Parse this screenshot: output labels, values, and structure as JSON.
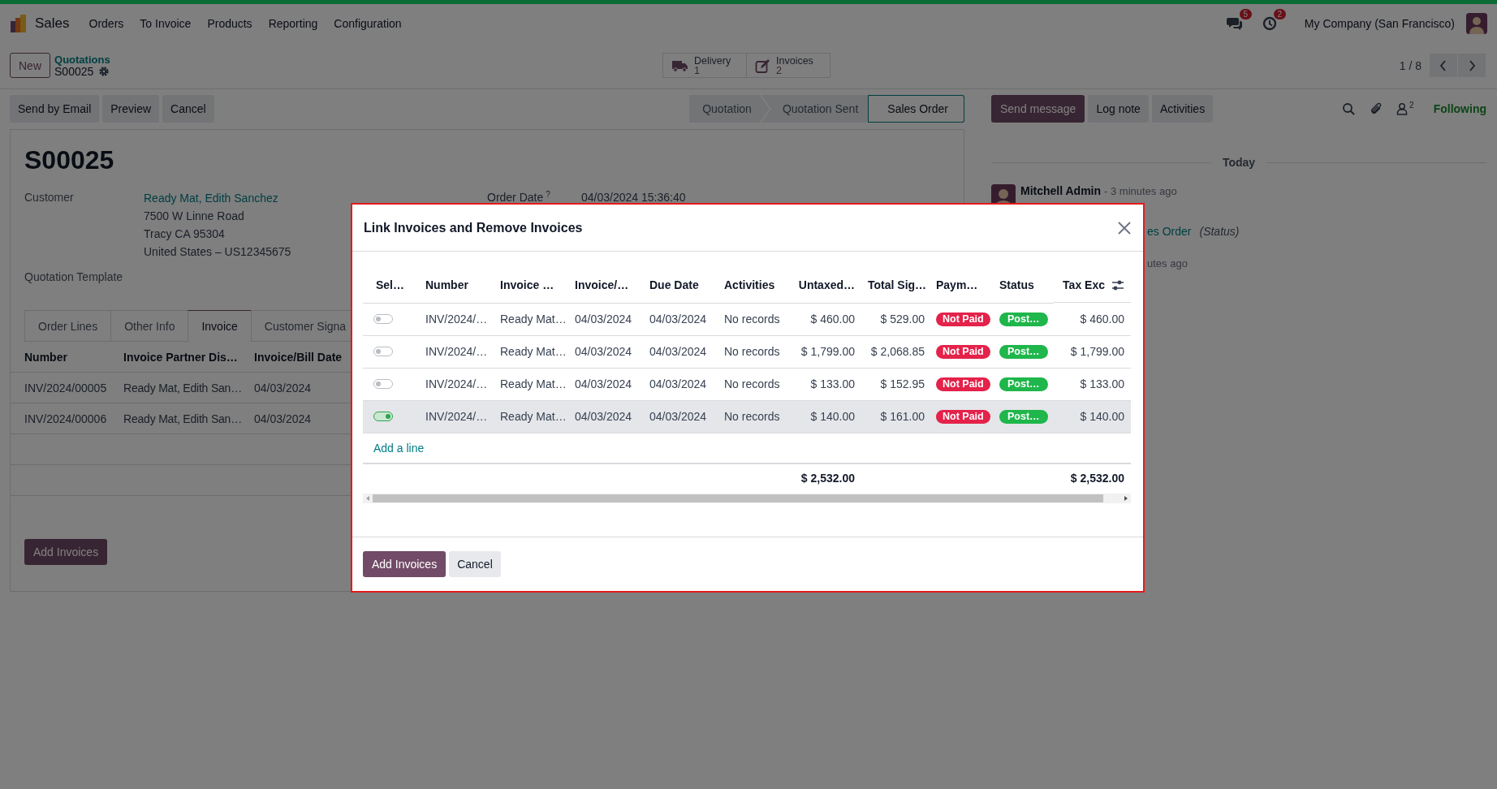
{
  "navbar": {
    "app": "Sales",
    "menu": [
      "Orders",
      "To Invoice",
      "Products",
      "Reporting",
      "Configuration"
    ],
    "message_count": "5",
    "activity_count": "2",
    "company": "My Company (San Francisco)"
  },
  "control_panel": {
    "new_button": "New",
    "breadcrumb": "Quotations",
    "record": "S00025",
    "smart_buttons": [
      {
        "kind": "delivery",
        "label": "Delivery",
        "count": "1"
      },
      {
        "kind": "invoices",
        "label": "Invoices",
        "count": "2"
      }
    ],
    "pager": "1 / 8"
  },
  "actions": [
    "Send by Email",
    "Preview",
    "Cancel"
  ],
  "statusbar": [
    {
      "label": "Quotation",
      "selected": false
    },
    {
      "label": "Quotation Sent",
      "selected": false
    },
    {
      "label": "Sales Order",
      "selected": true
    }
  ],
  "form": {
    "title": "S00025",
    "customer_label": "Customer",
    "customer": "Ready Mat, Edith Sanchez",
    "address": [
      "7500 W Linne Road",
      "Tracy CA 95304",
      "United States – US12345675"
    ],
    "order_date_label": "Order Date",
    "order_date_help": "?",
    "order_date": "04/03/2024 15:36:40",
    "template_label": "Quotation Template",
    "tabs": [
      {
        "label": "Order Lines",
        "selected": false
      },
      {
        "label": "Other Info",
        "selected": false
      },
      {
        "label": "Invoice",
        "selected": true
      },
      {
        "label": "Customer Signa",
        "selected": false
      }
    ],
    "invoice_table": {
      "columns": [
        "Number",
        "Invoice Partner Dis…",
        "Invoice/Bill Date"
      ],
      "rows": [
        [
          "INV/2024/00005",
          "Ready Mat, Edith San…",
          "04/03/2024"
        ],
        [
          "INV/2024/00006",
          "Ready Mat, Edith San…",
          "04/03/2024"
        ]
      ]
    },
    "add_button": "Add Invoices"
  },
  "chatter": {
    "buttons": [
      {
        "label": "Send message",
        "kind": "primary"
      },
      {
        "label": "Log note",
        "kind": "secondary"
      },
      {
        "label": "Activities",
        "kind": "secondary"
      }
    ],
    "follower_count": "2",
    "follow_state": "Following",
    "date_separator": "Today",
    "message": {
      "author": "Mitchell Admin",
      "time": "- 3 minutes ago",
      "link_fragment": "es Order",
      "note": "(Status)",
      "time_fragment": "utes ago"
    }
  },
  "dialog": {
    "title": "Link Invoices and Remove Invoices",
    "select_header": "Sel…",
    "columns": [
      {
        "label": "Number",
        "kind": "text"
      },
      {
        "label": "Invoice …",
        "kind": "text"
      },
      {
        "label": "Invoice/…",
        "kind": "text"
      },
      {
        "label": "Due Date",
        "kind": "text"
      },
      {
        "label": "Activities",
        "kind": "text"
      },
      {
        "label": "Untaxed…",
        "kind": "number",
        "total": "$ 2,532.00"
      },
      {
        "label": "Total Sig…",
        "kind": "number"
      },
      {
        "label": "Paym…",
        "kind": "payment"
      },
      {
        "label": "Status",
        "kind": "status"
      },
      {
        "label": "Tax Exc",
        "kind": "number",
        "total": "$ 2,532.00"
      }
    ],
    "rows": [
      {
        "selected": false,
        "cells": [
          "INV/2024/…",
          "Ready Mat…",
          "04/03/2024",
          "04/03/2024",
          "No records",
          "$ 460.00",
          "$ 529.00",
          "Not Paid",
          "Post…",
          "$ 460.00"
        ]
      },
      {
        "selected": false,
        "cells": [
          "INV/2024/…",
          "Ready Mat…",
          "04/03/2024",
          "04/03/2024",
          "No records",
          "$ 1,799.00",
          "$ 2,068.85",
          "Not Paid",
          "Post…",
          "$ 1,799.00"
        ]
      },
      {
        "selected": false,
        "cells": [
          "INV/2024/…",
          "Ready Mat…",
          "04/03/2024",
          "04/03/2024",
          "No records",
          "$ 133.00",
          "$ 152.95",
          "Not Paid",
          "Post…",
          "$ 133.00"
        ]
      },
      {
        "selected": true,
        "cells": [
          "INV/2024/…",
          "Ready Mat…",
          "04/03/2024",
          "04/03/2024",
          "No records",
          "$ 140.00",
          "$ 161.00",
          "Not Paid",
          "Post…",
          "$ 140.00"
        ]
      }
    ],
    "add_line": "Add a line",
    "buttons": [
      {
        "label": "Add Invoices",
        "kind": "primary"
      },
      {
        "label": "Cancel",
        "kind": "secondary"
      }
    ]
  }
}
